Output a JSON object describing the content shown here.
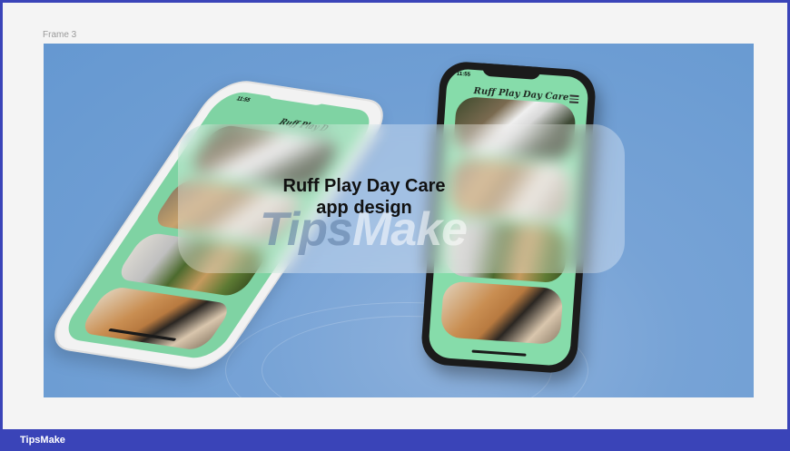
{
  "frame": {
    "label": "Frame 3"
  },
  "card": {
    "line1": "Ruff Play Day Care",
    "line2": "app design"
  },
  "watermark": {
    "part1": "Tips",
    "part2": "Make"
  },
  "phone_left": {
    "time": "11:55",
    "title": "Ruff Play D"
  },
  "phone_right": {
    "time": "11:55",
    "title": "Ruff Play Day Care"
  },
  "footer": {
    "brand": "TipsMake"
  },
  "colors": {
    "canvas": "#6d9dd3",
    "screen": "#86dcaa",
    "footer": "#3a44b8"
  }
}
